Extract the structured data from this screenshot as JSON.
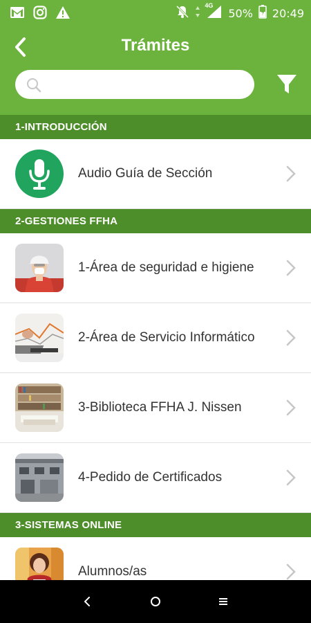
{
  "status_bar": {
    "battery_percent": "50%",
    "time": "20:49",
    "network": "4G",
    "left_icons": [
      "gmail-icon",
      "instagram-icon",
      "warning-icon"
    ],
    "right_icons": [
      "notifications-off-icon",
      "signal-icon",
      "battery-icon"
    ]
  },
  "header": {
    "title": "Trámites",
    "search_placeholder": "",
    "back_icon": "back-arrow-icon",
    "filter_icon": "filter-icon"
  },
  "sections": [
    {
      "title": "1-INTRODUCCIÓN",
      "items": [
        {
          "label": "Audio Guía de Sección",
          "thumb": "microphone-icon"
        }
      ]
    },
    {
      "title": "2-GESTIONES FFHA",
      "items": [
        {
          "label": "1-Área de seguridad e higiene",
          "thumb": "safety-worker-photo"
        },
        {
          "label": "2-Área de Servicio Informático",
          "thumb": "laptop-photo"
        },
        {
          "label": "3-Biblioteca FFHA J. Nissen",
          "thumb": "library-photo"
        },
        {
          "label": "4-Pedido de Certificados",
          "thumb": "building-photo"
        }
      ]
    },
    {
      "title": "3-SISTEMAS ONLINE",
      "items": [
        {
          "label": "Alumnos/as",
          "thumb": "student-photo"
        }
      ]
    }
  ],
  "colors": {
    "primary": "#6cb33e",
    "section": "#4e8e2a",
    "audio_circle": "#20a45e"
  }
}
